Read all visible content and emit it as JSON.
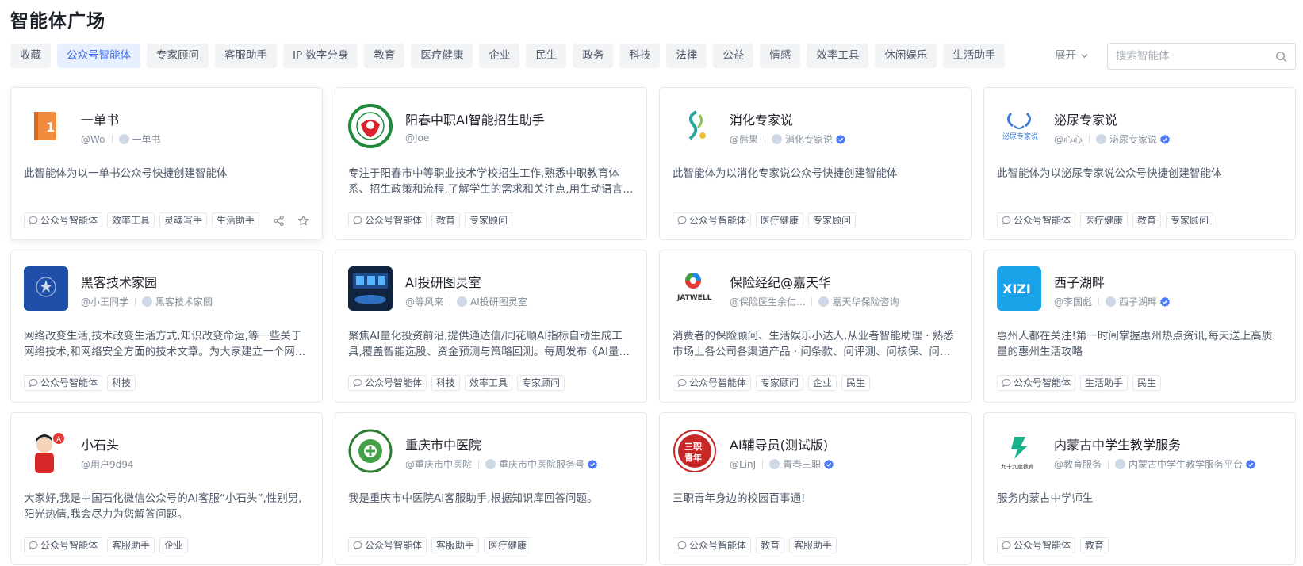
{
  "page": {
    "title": "智能体广场"
  },
  "tabs": [
    {
      "label": "收藏",
      "active": false
    },
    {
      "label": "公众号智能体",
      "active": true
    },
    {
      "label": "专家顾问",
      "active": false
    },
    {
      "label": "客服助手",
      "active": false
    },
    {
      "label": "IP 数字分身",
      "active": false
    },
    {
      "label": "教育",
      "active": false
    },
    {
      "label": "医疗健康",
      "active": false
    },
    {
      "label": "企业",
      "active": false
    },
    {
      "label": "民生",
      "active": false
    },
    {
      "label": "政务",
      "active": false
    },
    {
      "label": "科技",
      "active": false
    },
    {
      "label": "法律",
      "active": false
    },
    {
      "label": "公益",
      "active": false
    },
    {
      "label": "情感",
      "active": false
    },
    {
      "label": "效率工具",
      "active": false
    },
    {
      "label": "休闲娱乐",
      "active": false
    },
    {
      "label": "生活助手",
      "active": false
    }
  ],
  "expand_label": "展开",
  "search": {
    "placeholder": "搜索智能体"
  },
  "colors": {
    "accent": "#3c6cf0",
    "verified": "#4e7cf6"
  },
  "cards": [
    {
      "name": "一单书",
      "author": "@Wo",
      "source": "一单书",
      "verified": false,
      "avatar_icon": "book-icon",
      "desc": "此智能体为以一单书公众号快捷创建智能体",
      "tags": [
        "公众号智能体",
        "效率工具",
        "灵魂写手",
        "生活助手"
      ],
      "show_actions": true
    },
    {
      "name": "阳春中职AI智能招生助手",
      "author": "@Joe",
      "source": "",
      "verified": false,
      "avatar_icon": "school-seal-icon",
      "desc": "专注于阳春市中等职业技术学校招生工作,熟悉中职教育体系、招生政策和流程,了解学生的需求和关注点,用生动语言解答问题。",
      "tags": [
        "公众号智能体",
        "教育",
        "专家顾问"
      ],
      "show_actions": false
    },
    {
      "name": "消化专家说",
      "author": "@熊果",
      "source": "消化专家说",
      "verified": true,
      "avatar_icon": "digestion-logo-icon",
      "desc": "此智能体为以消化专家说公众号快捷创建智能体",
      "tags": [
        "公众号智能体",
        "医疗健康",
        "专家顾问"
      ],
      "show_actions": false
    },
    {
      "name": "泌尿专家说",
      "author": "@心心",
      "source": "泌尿专家说",
      "verified": true,
      "avatar_icon": "urology-logo-icon",
      "desc": "此智能体为以泌尿专家说公众号快捷创建智能体",
      "tags": [
        "公众号智能体",
        "医疗健康",
        "教育",
        "专家顾问"
      ],
      "show_actions": false
    },
    {
      "name": "黑客技术家园",
      "author": "@小王同学",
      "source": "黑客技术家园",
      "verified": false,
      "avatar_icon": "hacker-logo-icon",
      "desc": "网络改变生活,技术改变生活方式,知识改变命运,等一些关于网络技术,和网络安全方面的技术文章。为大家建立一个网络安全交流的平台。",
      "tags": [
        "公众号智能体",
        "科技"
      ],
      "show_actions": false
    },
    {
      "name": "AI投研图灵室",
      "author": "@等风来",
      "source": "AI投研图灵室",
      "verified": false,
      "avatar_icon": "trading-room-icon",
      "desc": "聚焦AI量化投资前沿,提供通达信/同花顺AI指标自动生成工具,覆盖智能选股、资金预测与策略回测。每周发布《AI量化周报》。",
      "tags": [
        "公众号智能体",
        "科技",
        "效率工具",
        "专家顾问"
      ],
      "show_actions": false
    },
    {
      "name": "保险经纪@嘉天华",
      "author": "@保险医生余仁...",
      "source": "嘉天华保险咨询",
      "verified": false,
      "avatar_icon": "jatwell-logo-icon",
      "desc": "消费者的保险顾问、生活娱乐小达人,从业者智能助理 · 熟悉市场上各公司各渠道产品 · 问条款、问评测、问核保、问理赔。",
      "tags": [
        "公众号智能体",
        "专家顾问",
        "企业",
        "民生"
      ],
      "show_actions": false
    },
    {
      "name": "西子湖畔",
      "author": "@李国彪",
      "source": "西子湖畔",
      "verified": true,
      "avatar_icon": "xizi-logo-icon",
      "desc": "惠州人都在关注!第一时间掌握惠州热点资讯,每天送上高质量的惠州生活攻略",
      "tags": [
        "公众号智能体",
        "生活助手",
        "民生"
      ],
      "show_actions": false
    },
    {
      "name": "小石头",
      "author": "@用户9d94",
      "source": "",
      "verified": false,
      "avatar_icon": "mascot-avatar-icon",
      "desc": "大家好,我是中国石化微信公众号的AI客服“小石头”,性别男,阳光热情,我会尽力为您解答问题。",
      "tags": [
        "公众号智能体",
        "客服助手",
        "企业"
      ],
      "show_actions": false
    },
    {
      "name": "重庆市中医院",
      "author": "@重庆市中医院",
      "source": "重庆市中医院服务号",
      "verified": true,
      "avatar_icon": "hospital-seal-icon",
      "desc": "我是重庆市中医院AI客服助手,根据知识库回答问题。",
      "tags": [
        "公众号智能体",
        "客服助手",
        "医疗健康"
      ],
      "show_actions": false
    },
    {
      "name": "AI辅导员(测试版)",
      "author": "@LinJ",
      "source": "青春三职",
      "verified": true,
      "avatar_icon": "youth-seal-icon",
      "desc": "三职青年身边的校园百事通!",
      "tags": [
        "公众号智能体",
        "教育",
        "客服助手"
      ],
      "show_actions": false
    },
    {
      "name": "内蒙古中学生教学服务",
      "author": "@教育服务",
      "source": "内蒙古中学生教学服务平台",
      "verified": true,
      "avatar_icon": "education-logo-icon",
      "desc": "服务内蒙古中学师生",
      "tags": [
        "公众号智能体",
        "教育"
      ],
      "show_actions": false
    }
  ]
}
